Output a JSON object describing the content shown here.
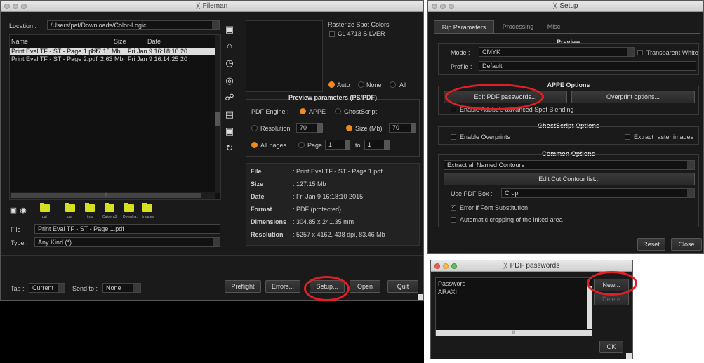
{
  "fileman": {
    "title": "Fileman",
    "location_label": "Location",
    "location_value": "/Users/pat/Downloads/Color-Logic",
    "columns": [
      "Name",
      "Size",
      "Date"
    ],
    "files": [
      {
        "name": "Print Eval TF - ST - Page 1.pdf",
        "size": "127.15 Mb",
        "date": "Fri Jan  9 16:18:10 20"
      },
      {
        "name": "Print Eval TF - ST - Page 2.pdf",
        "size": "2.63 Mb",
        "date": "Fri Jan  9 16:14:25 20"
      }
    ],
    "folders": [
      "pat",
      "pat",
      "tmp",
      "Caldera3",
      "Downloa..",
      "images"
    ],
    "file_label": "File",
    "file_value": "Print Eval TF - ST - Page 1.pdf",
    "type_label": "Type",
    "type_value": "Any Kind (*)",
    "rasterize_label": "Rasterize Spot Colors",
    "spot_color": "CL 4713 SILVER",
    "spot_mode": {
      "auto": "Auto",
      "none": "None",
      "all": "All"
    },
    "preview_params_title": "Preview parameters (PS/PDF)",
    "pdf_engine_label": "PDF Engine",
    "engine_appe": "APPE",
    "engine_ghost": "GhostScript",
    "resolution_label": "Resolution",
    "resolution_value": "70",
    "size_label": "Size (Mb)",
    "size_value": "70",
    "all_pages_label": "All pages",
    "page_label": "Page",
    "page_from": "1",
    "to_label": "to",
    "page_to": "1",
    "info": [
      {
        "key": "File",
        "value": "Print Eval TF - ST - Page 1.pdf"
      },
      {
        "key": "Size",
        "value": "127.15 Mb"
      },
      {
        "key": "Date",
        "value": "Fri Jan  9 16:18:10 2015"
      },
      {
        "key": "Format",
        "value": "PDF (protected)"
      },
      {
        "key": "Dimensions",
        "value": "304.85 x 241.35 mm"
      },
      {
        "key": "Resolution",
        "value": "5257 x 4162, 438 dpi, 83.46 Mb"
      }
    ],
    "tab_label": "Tab",
    "tab_value": "Current",
    "send_to_label": "Send to",
    "send_to_value": "None",
    "buttons": {
      "preflight": "Preflight",
      "errors": "Errors...",
      "setup": "Setup...",
      "open": "Open",
      "quit": "Quit"
    }
  },
  "setup": {
    "title": "Setup",
    "tabs": [
      "Rip Parameters",
      "Processing",
      "Misc"
    ],
    "preview_title": "Preview",
    "mode_label": "Mode",
    "mode_value": "CMYK",
    "transparent_white": "Transparent White",
    "profile_label": "Profile",
    "profile_value": "Default",
    "appe_title": "APPE Options",
    "edit_pdf_passwords": "Edit PDF passwords...",
    "overprint_options": "Overprint options...",
    "enable_spot_blending": "Enable Adobe's advanced Spot Blending",
    "ghostscript_title": "GhostScript Options",
    "enable_overprints": "Enable Overprints",
    "extract_raster": "Extract raster images",
    "common_title": "Common Options",
    "contours_value": "Extract all Named Contours",
    "edit_cut_contour": "Edit Cut Contour list...",
    "pdf_box_label": "Use PDF Box",
    "pdf_box_value": "Crop",
    "error_font": "Error if Font Substitution",
    "auto_crop": "Automatic cropping of the inked area",
    "reset": "Reset",
    "close": "Close"
  },
  "passwords": {
    "title": "PDF passwords",
    "column": "Password",
    "items": [
      "ARAXI"
    ],
    "new": "New...",
    "delete": "Delete",
    "ok": "OK"
  },
  "colors": {
    "accent": "#f08a1c",
    "highlight_circle": "#e31e24",
    "folder": "#d7df23"
  }
}
